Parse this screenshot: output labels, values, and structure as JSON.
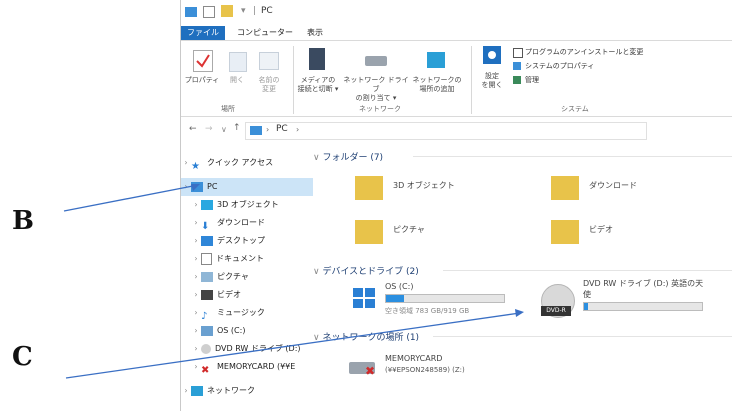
{
  "window": {
    "title_path": "PC"
  },
  "ribbon": {
    "tabs": [
      "ファイル",
      "コンピューター",
      "表示"
    ],
    "buttons": {
      "properties": "プロパティ",
      "open": "開く",
      "rename": "名前の\n変更",
      "media": "メディアの\n接続と切断 ▾",
      "network_drive": "ネットワーク ドライブ\nの割り当て ▾",
      "add_location": "ネットワークの\n場所の追加",
      "settings": "設定\nを開く",
      "uninstall": "プログラムのアンインストールと変更",
      "sys_props": "システムのプロパティ",
      "manage": "管理"
    },
    "groups": {
      "location": "場所",
      "network": "ネットワーク",
      "system": "システム"
    }
  },
  "address": {
    "path": "PC",
    "sep": "›"
  },
  "nav": {
    "quick_access": "クイック アクセス",
    "pc": "PC",
    "objects3d": "3D オブジェクト",
    "downloads": "ダウンロード",
    "desktop": "デスクトップ",
    "documents": "ドキュメント",
    "pictures": "ピクチャ",
    "videos": "ビデオ",
    "music": "ミュージック",
    "os_c": "OS (C:)",
    "dvd": "DVD RW ドライブ (D:)",
    "memcard": "MEMORYCARD (¥¥E",
    "network": "ネットワーク"
  },
  "content": {
    "folders_header": "フォルダー (7)",
    "folders": {
      "objects3d": "3D オブジェクト",
      "downloads": "ダウンロード",
      "pictures": "ピクチャ",
      "videos": "ビデオ"
    },
    "devices_header": "デバイスとドライブ (2)",
    "os": {
      "name": "OS (C:)",
      "free": "空き領域 783 GB/919 GB",
      "used_fraction": 0.15
    },
    "dvd": {
      "name": "DVD RW ドライブ (D:) 英語の天",
      "name2": "使",
      "badge": "DVD-R",
      "used_fraction": 0.03
    },
    "network_header": "ネットワークの場所 (1)",
    "memcard": {
      "name": "MEMORYCARD",
      "path": "(¥¥EPSON248589) (Z:)"
    }
  },
  "annotations": {
    "b": "B",
    "c": "C",
    "arrow_color": "#3a6fc4"
  }
}
